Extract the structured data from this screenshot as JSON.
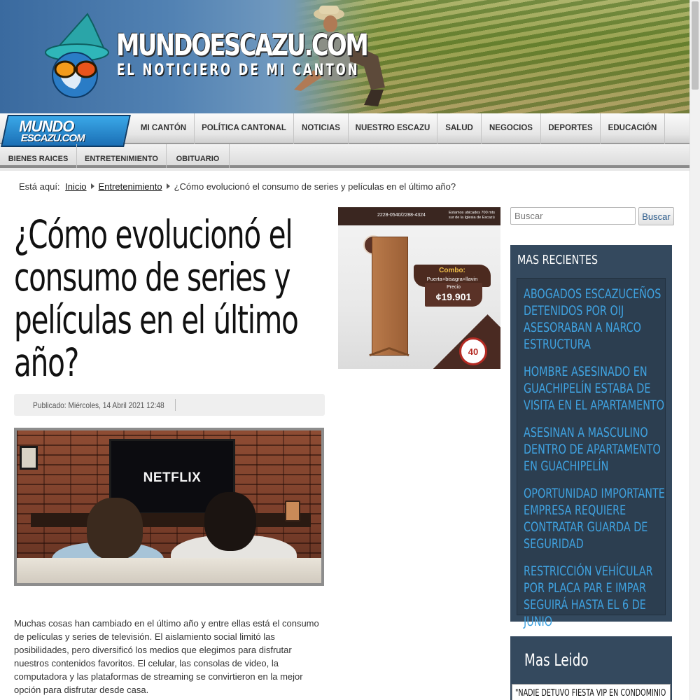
{
  "header": {
    "site_title": "MUNDOESCAZU.COM",
    "slogan": "EL NOTICIERO DE MI CANTON"
  },
  "nav": {
    "logo_line1": "MUNDO",
    "logo_line2": "ESCAZU.COM",
    "row1": [
      "MI CANTÓN",
      "POLÍTICA CANTONAL",
      "NOTICIAS",
      "NUESTRO ESCAZU",
      "SALUD",
      "NEGOCIOS",
      "DEPORTES",
      "EDUCACIÓN"
    ],
    "row2": [
      "BIENES RAICES",
      "ENTRETENIMIENTO",
      "OBITUARIO"
    ]
  },
  "breadcrumb": {
    "prefix": "Está aquí:",
    "items": [
      "Inicio",
      "Entretenimiento"
    ],
    "current": "¿Cómo evolucionó el consumo de series y películas en el último año?"
  },
  "article": {
    "title": "¿Cómo evolucionó el consumo de series y películas en el último año?",
    "published": "Publicado: Miércoles, 14 Abril 2021 12:48",
    "image_tv_text": "NETFLIX",
    "body": "Muchas cosas han cambiado en el último año y entre ellas está el consumo de películas y series de televisión. El aislamiento social limitó las posibilidades, pero diversificó los medios que elegimos para disfrutar nuestros contenidos favoritos. El celular, las consolas de video, la computadora y las plataformas de streaming se convirtieron en la mejor opción para disfrutar desde casa."
  },
  "ad": {
    "phone": "2228-0540/2288-4324",
    "address": "Estamos ubicados 700 mts sur de la Iglesia de Escazú",
    "combo_title": "Combo:",
    "combo_items": "Puerta+bisagra+llavin",
    "precio_label": "Precio",
    "price": "¢19.901",
    "badge": "40"
  },
  "search": {
    "placeholder": "Buscar",
    "button_label": "Buscar"
  },
  "sidebar": {
    "recent_title": "MAS RECIENTES",
    "recent_items": [
      "ABOGADOS ESCAZUCEÑOS DETENIDOS POR OIJ ASESORABAN A NARCO ESTRUCTURA",
      "HOMBRE ASESINADO EN GUACHIPELÍN ESTABA DE VISITA EN EL APARTAMENTO",
      "ASESINAN A MASCULINO DENTRO DE APARTAMENTO EN GUACHIPELÍN",
      "OPORTUNIDAD IMPORTANTE EMPRESA REQUIERE CONTRATAR GUARDA DE SEGURIDAD",
      "RESTRICCIÓN VEHÍCULAR POR PLACA PAR E IMPAR SEGUIRÁ HASTA EL 6 DE JUNIO"
    ],
    "leido_title": "Mas Leido",
    "leido_first": "\"NADIE DETUVO FIESTA VIP EN CONDOMINIO"
  },
  "colors": {
    "sidebar_bg": "#34495e",
    "link_blue": "#3fa2e0",
    "nav_logo_blue": "#1b6fb5"
  }
}
